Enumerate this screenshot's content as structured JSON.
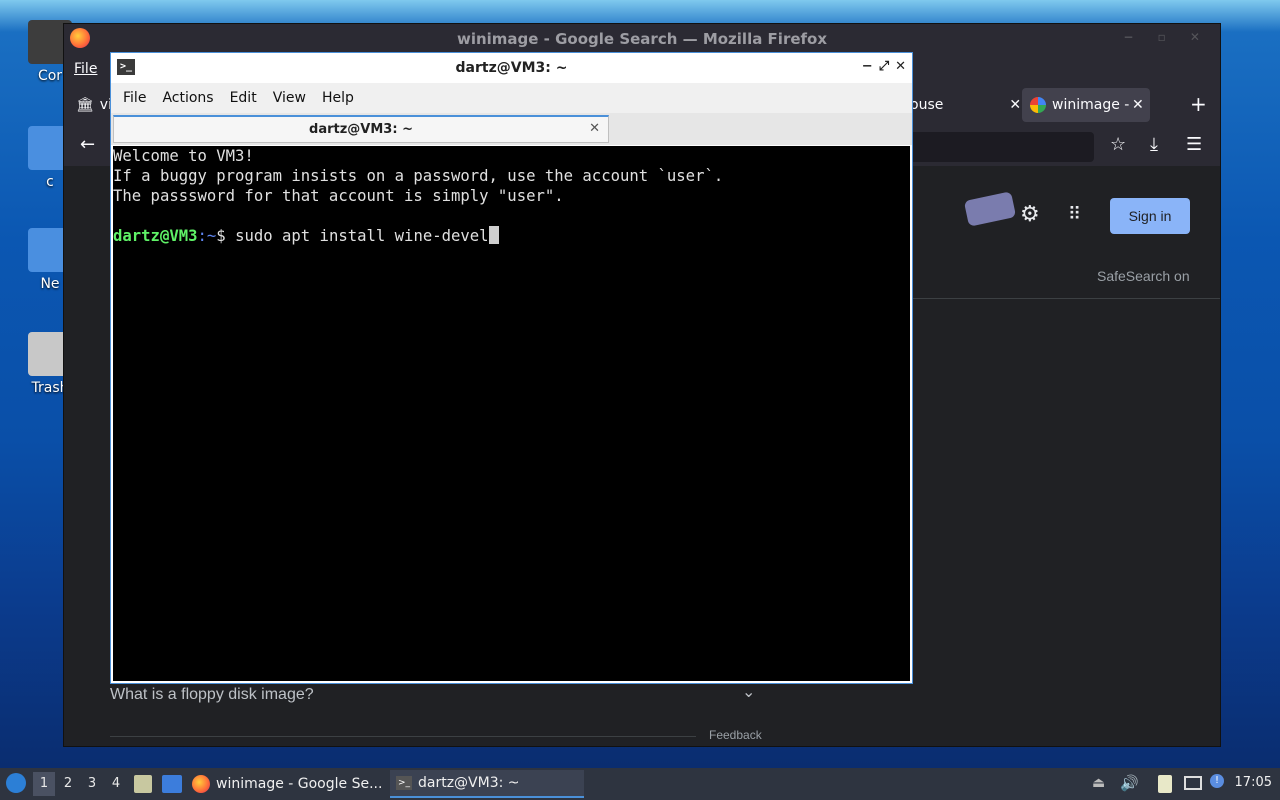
{
  "desktop": {
    "icons": [
      {
        "label": "Cor"
      },
      {
        "label": "c"
      },
      {
        "label": "Ne"
      },
      {
        "label": "Trash"
      }
    ]
  },
  "firefox": {
    "title": "winimage - Google Search — Mozilla Firefox",
    "menu_file": "File",
    "tab_left_label": "vi",
    "tab_mid_label": "ouse",
    "tab_active_label": "winimage - Google Search",
    "new_tab": "+",
    "sign_in": "Sign in",
    "safesearch": "SafeSearch on",
    "faq_question": "What is a floppy disk image?",
    "feedback": "Feedback"
  },
  "terminal": {
    "title": "dartz@VM3: ~",
    "menu": [
      "File",
      "Actions",
      "Edit",
      "View",
      "Help"
    ],
    "tab_label": "dartz@VM3: ~",
    "lines": [
      "Welcome to VM3!",
      "If a buggy program insists on a password, use the account `user`.",
      "The passsword for that account is simply \"user\"."
    ],
    "prompt_user": "dartz@VM3",
    "prompt_path": ":~",
    "prompt_symbol": "$ ",
    "command": "sudo apt install wine-devel"
  },
  "taskbar": {
    "workspaces": [
      "1",
      "2",
      "3",
      "4"
    ],
    "task_firefox": "winimage - Google Se...",
    "task_terminal": "dartz@VM3: ~",
    "clock": "17:05"
  }
}
